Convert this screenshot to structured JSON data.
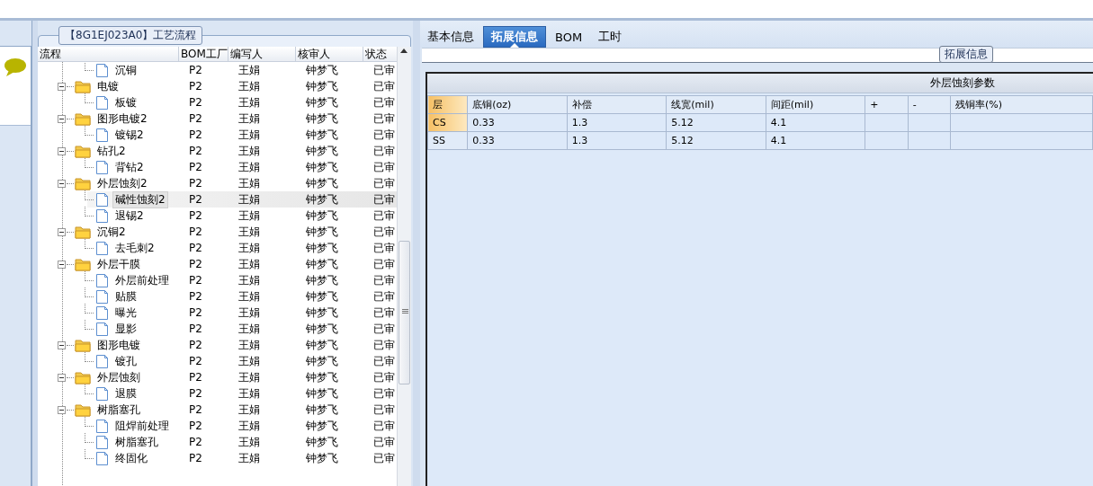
{
  "process_panel": {
    "title": "【8G1EJ023A0】工艺流程",
    "columns": [
      "流程",
      "BOM工厂",
      "编写人",
      "核审人",
      "状态"
    ],
    "rows": [
      {
        "kind": "file",
        "cells": [
          "沉铜",
          "P2",
          "王娟",
          "钟梦飞",
          "已审"
        ],
        "selected": false
      },
      {
        "kind": "folder",
        "expanded": true,
        "cells": [
          "电镀",
          "P2",
          "王娟",
          "钟梦飞",
          "已审"
        ],
        "selected": false,
        "children": [
          {
            "kind": "file",
            "cells": [
              "板镀",
              "P2",
              "王娟",
              "钟梦飞",
              "已审"
            ],
            "selected": false
          }
        ]
      },
      {
        "kind": "folder",
        "expanded": true,
        "cells": [
          "图形电镀2",
          "P2",
          "王娟",
          "钟梦飞",
          "已审"
        ],
        "selected": false,
        "children": [
          {
            "kind": "file",
            "cells": [
              "镀锡2",
              "P2",
              "王娟",
              "钟梦飞",
              "已审"
            ],
            "selected": false
          }
        ]
      },
      {
        "kind": "folder",
        "expanded": true,
        "cells": [
          "钻孔2",
          "P2",
          "王娟",
          "钟梦飞",
          "已审"
        ],
        "selected": false,
        "children": [
          {
            "kind": "file",
            "cells": [
              "背钻2",
              "P2",
              "王娟",
              "钟梦飞",
              "已审"
            ],
            "selected": false
          }
        ]
      },
      {
        "kind": "folder",
        "expanded": true,
        "cells": [
          "外层蚀刻2",
          "P2",
          "王娟",
          "钟梦飞",
          "已审"
        ],
        "selected": false,
        "children": [
          {
            "kind": "file",
            "cells": [
              "碱性蚀刻2",
              "P2",
              "王娟",
              "钟梦飞",
              "已审"
            ],
            "selected": true
          },
          {
            "kind": "file",
            "cells": [
              "退锡2",
              "P2",
              "王娟",
              "钟梦飞",
              "已审"
            ],
            "selected": false
          }
        ]
      },
      {
        "kind": "folder",
        "expanded": true,
        "cells": [
          "沉铜2",
          "P2",
          "王娟",
          "钟梦飞",
          "已审"
        ],
        "selected": false,
        "children": [
          {
            "kind": "file",
            "cells": [
              "去毛刺2",
              "P2",
              "王娟",
              "钟梦飞",
              "已审"
            ],
            "selected": false
          }
        ]
      },
      {
        "kind": "folder",
        "expanded": true,
        "cells": [
          "外层干膜",
          "P2",
          "王娟",
          "钟梦飞",
          "已审"
        ],
        "selected": false,
        "children": [
          {
            "kind": "file",
            "cells": [
              "外层前处理",
              "P2",
              "王娟",
              "钟梦飞",
              "已审"
            ],
            "selected": false
          },
          {
            "kind": "file",
            "cells": [
              "贴膜",
              "P2",
              "王娟",
              "钟梦飞",
              "已审"
            ],
            "selected": false
          },
          {
            "kind": "file",
            "cells": [
              "曝光",
              "P2",
              "王娟",
              "钟梦飞",
              "已审"
            ],
            "selected": false
          },
          {
            "kind": "file",
            "cells": [
              "显影",
              "P2",
              "王娟",
              "钟梦飞",
              "已审"
            ],
            "selected": false
          }
        ]
      },
      {
        "kind": "folder",
        "expanded": true,
        "cells": [
          "图形电镀",
          "P2",
          "王娟",
          "钟梦飞",
          "已审"
        ],
        "selected": false,
        "children": [
          {
            "kind": "file",
            "cells": [
              "镀孔",
              "P2",
              "王娟",
              "钟梦飞",
              "已审"
            ],
            "selected": false
          }
        ]
      },
      {
        "kind": "folder",
        "expanded": true,
        "cells": [
          "外层蚀刻",
          "P2",
          "王娟",
          "钟梦飞",
          "已审"
        ],
        "selected": false,
        "children": [
          {
            "kind": "file",
            "cells": [
              "退膜",
              "P2",
              "王娟",
              "钟梦飞",
              "已审"
            ],
            "selected": false
          }
        ]
      },
      {
        "kind": "folder",
        "expanded": true,
        "cells": [
          "树脂塞孔",
          "P2",
          "王娟",
          "钟梦飞",
          "已审"
        ],
        "selected": false,
        "children": [
          {
            "kind": "file",
            "cells": [
              "阻焊前处理",
              "P2",
              "王娟",
              "钟梦飞",
              "已审"
            ],
            "selected": false
          },
          {
            "kind": "file",
            "cells": [
              "树脂塞孔",
              "P2",
              "王娟",
              "钟梦飞",
              "已审"
            ],
            "selected": false
          },
          {
            "kind": "file",
            "cells": [
              "终固化",
              "P2",
              "王娟",
              "钟梦飞",
              "已审"
            ],
            "selected": false
          }
        ]
      }
    ]
  },
  "detail_panel": {
    "tabs": [
      {
        "label": "基本信息",
        "selected": false
      },
      {
        "label": "拓展信息",
        "selected": true
      },
      {
        "label": "BOM",
        "selected": false
      },
      {
        "label": "工时",
        "selected": false
      }
    ],
    "group_title": "拓展信息",
    "grid_title": "外层蚀刻参数",
    "columns": [
      "层",
      "底铜(oz)",
      "补偿",
      "线宽(mil)",
      "间距(mil)",
      "+",
      "-",
      "残铜率(%)"
    ],
    "rows": [
      {
        "cells": [
          "CS",
          "0.33",
          "1.3",
          "5.12",
          "4.1",
          "",
          "",
          ""
        ],
        "selected": true
      },
      {
        "cells": [
          "SS",
          "0.33",
          "1.3",
          "5.12",
          "4.1",
          "",
          "",
          ""
        ],
        "selected": false
      }
    ]
  }
}
